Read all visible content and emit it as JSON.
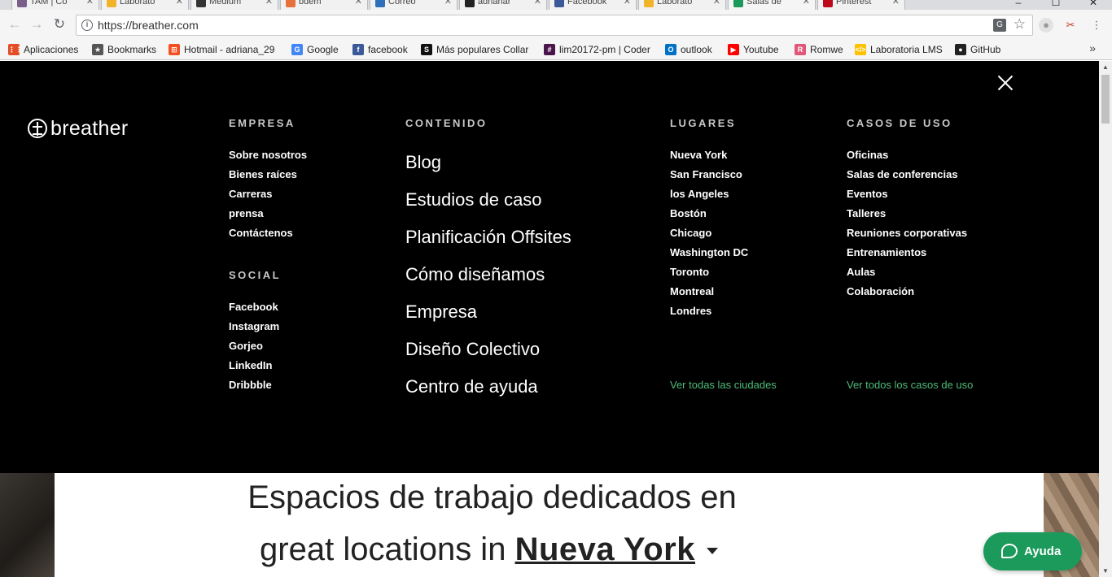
{
  "browser": {
    "tabs": [
      {
        "label": "TAM | Co",
        "color": "#7a5f8a"
      },
      {
        "label": "Laborato",
        "color": "#f0b429"
      },
      {
        "label": "Medium",
        "color": "#333333"
      },
      {
        "label": "bdem",
        "color": "#e8703a"
      },
      {
        "label": "Correo",
        "color": "#2f6fba"
      },
      {
        "label": "adrianar",
        "color": "#222222"
      },
      {
        "label": "Facebook",
        "color": "#3b5998"
      },
      {
        "label": "Laborato",
        "color": "#f0b429"
      },
      {
        "label": "Salas de",
        "color": "#1b9a5b"
      },
      {
        "label": "Pinterest",
        "color": "#bd081c"
      }
    ],
    "address": {
      "url": "https://breather.com"
    },
    "bookmarks": [
      {
        "label": "Aplicaciones",
        "icon": "apps-grid-icon",
        "color": "#e44d26"
      },
      {
        "label": "Bookmarks",
        "icon": "star-icon",
        "color": "#555555"
      },
      {
        "label": "Hotmail - adriana_29",
        "icon": "windows-icon",
        "color": "#f25022"
      },
      {
        "label": "Google",
        "icon": "google-icon",
        "color": "#4285f4"
      },
      {
        "label": "facebook",
        "icon": "facebook-icon",
        "color": "#3b5998"
      },
      {
        "label": "Más populares Collar",
        "icon": "s-icon",
        "color": "#111111"
      },
      {
        "label": "lim20172-pm | Coder",
        "icon": "slack-icon",
        "color": "#4a154b"
      },
      {
        "label": "outlook",
        "icon": "outlook-icon",
        "color": "#0072c6"
      },
      {
        "label": "Youtube",
        "icon": "youtube-icon",
        "color": "#ff0000"
      },
      {
        "label": "Romwe",
        "icon": "romwe-icon",
        "color": "#e0577a"
      },
      {
        "label": "Laboratoria LMS",
        "icon": "laboratoria-icon",
        "color": "#ffc200"
      },
      {
        "label": "GitHub",
        "icon": "github-icon",
        "color": "#222222"
      }
    ],
    "bookmarks_more": "»"
  },
  "menu": {
    "brand": "breather",
    "empresa": {
      "heading": "EMPRESA",
      "items": [
        "Sobre nosotros",
        "Bienes raíces",
        "Carreras",
        "prensa",
        "Contáctenos"
      ]
    },
    "social": {
      "heading": "SOCIAL",
      "items": [
        "Facebook",
        "Instagram",
        "Gorjeo",
        "LinkedIn",
        "Dribbble"
      ]
    },
    "contenido": {
      "heading": "CONTENIDO",
      "items": [
        "Blog",
        "Estudios de caso",
        "Planificación Offsites",
        "Cómo diseñamos",
        "Empresa",
        "Diseño Colectivo",
        "Centro de ayuda"
      ]
    },
    "lugares": {
      "heading": "LUGARES",
      "items": [
        "Nueva York",
        "San Francisco",
        "los Angeles",
        "Bostón",
        "Chicago",
        "Washington DC",
        "Toronto",
        "Montreal",
        "Londres"
      ],
      "all_link": "Ver todas las ciudades"
    },
    "casos": {
      "heading": "CASOS DE USO",
      "items": [
        "Oficinas",
        "Salas de conferencias",
        "Eventos",
        "Talleres",
        "Reuniones corporativas",
        "Entrenamientos",
        "Aulas",
        "Colaboración"
      ],
      "all_link": "Ver todos los casos de uso"
    },
    "link_color": "#4dbb79"
  },
  "hero": {
    "line1": "Espacios de trabajo dedicados en",
    "line2_prefix": "great locations in",
    "city": "Nueva York"
  },
  "help_button": {
    "label": "Ayuda",
    "color": "#1b9a5b"
  }
}
